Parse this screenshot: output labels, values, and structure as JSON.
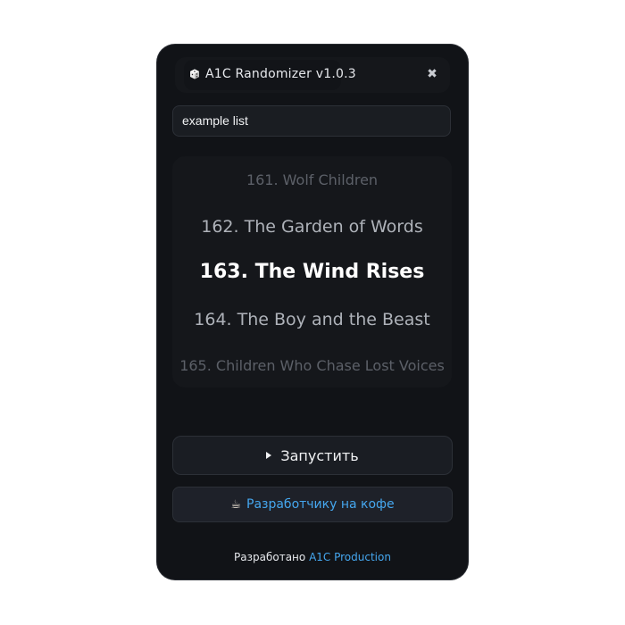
{
  "window": {
    "title": "A1C Randomizer v1.0.3",
    "title_icon": "dice-icon",
    "close_icon": "close-icon",
    "close_glyph": "✖"
  },
  "list_select": {
    "value": "example list"
  },
  "wheel": {
    "items": [
      "161. Wolf Children",
      "162. The Garden of Words",
      "163. The Wind Rises",
      "164. The Boy and the Beast",
      "165. Children Who Chase Lost Voices"
    ],
    "selected_index": 2
  },
  "actions": {
    "run_label": "Запустить",
    "run_icon": "play-icon",
    "coffee_label": "Разработчику на кофе",
    "coffee_icon": "coffee-icon",
    "coffee_glyph": "☕"
  },
  "footer": {
    "prefix": "Разработано",
    "link_text": "A1C Production"
  },
  "colors": {
    "background": "#111317",
    "accent_link": "#45a7ef",
    "text_primary": "#ffffff",
    "text_muted": "#5c6068"
  }
}
